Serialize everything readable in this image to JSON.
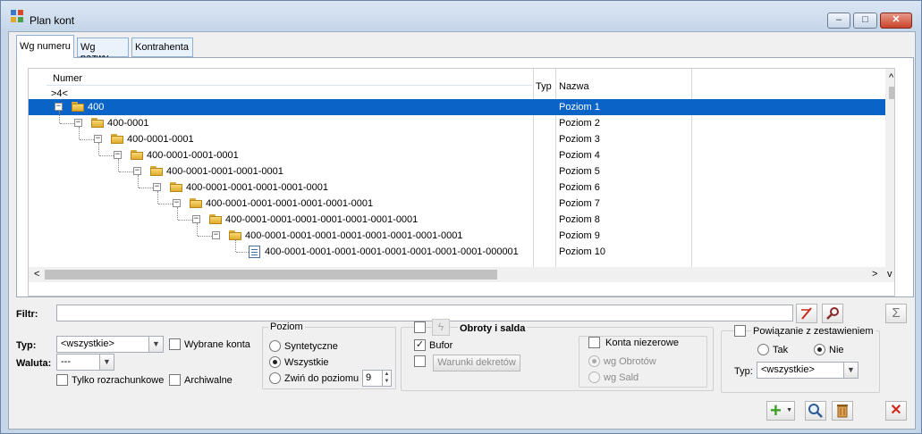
{
  "window": {
    "title": "Plan kont",
    "minimize": "–",
    "maximize": "□",
    "close": "✕"
  },
  "tabs": [
    "Wg numeru",
    "Wg nazwy",
    "Kontrahenta"
  ],
  "grid": {
    "col_numer": "Numer",
    "filter_value": ">4<",
    "col_typ": "Typ",
    "col_nazwa": "Nazwa",
    "rows": [
      {
        "numer": "400",
        "nazwa": "Poziom 1"
      },
      {
        "numer": "400-0001",
        "nazwa": "Poziom 2"
      },
      {
        "numer": "400-0001-0001",
        "nazwa": "Poziom 3"
      },
      {
        "numer": "400-0001-0001-0001",
        "nazwa": "Poziom 4"
      },
      {
        "numer": "400-0001-0001-0001-0001",
        "nazwa": "Poziom 5"
      },
      {
        "numer": "400-0001-0001-0001-0001-0001",
        "nazwa": "Poziom 6"
      },
      {
        "numer": "400-0001-0001-0001-0001-0001-0001",
        "nazwa": "Poziom 7"
      },
      {
        "numer": "400-0001-0001-0001-0001-0001-0001-0001",
        "nazwa": "Poziom 8"
      },
      {
        "numer": "400-0001-0001-0001-0001-0001-0001-0001-0001",
        "nazwa": "Poziom 9"
      },
      {
        "numer": "400-0001-0001-0001-0001-0001-0001-0001-0001-000001",
        "nazwa": "Poziom 10"
      }
    ],
    "expander_sign": "−",
    "scroll_up": "^",
    "scroll_down": "v",
    "scroll_left": "<",
    "scroll_right": ">"
  },
  "filter": {
    "label": "Filtr:",
    "value": "",
    "sigma": "Σ"
  },
  "left": {
    "typ_label": "Typ:",
    "typ_value": "<wszystkie>",
    "waluta_label": "Waluta:",
    "waluta_value": "---",
    "wybrane_konta": "Wybrane konta",
    "tylko_rozrachunkowe": "Tylko rozrachunkowe",
    "archiwalne": "Archiwalne"
  },
  "poziom": {
    "legend": "Poziom",
    "syntetyczne": "Syntetyczne",
    "wszystkie": "Wszystkie",
    "zwin": "Zwiń do poziomu",
    "zwin_value": "9",
    "selected": "Wszystkie"
  },
  "obroty": {
    "legend": "Obroty i salda",
    "bufor": "Bufor",
    "warunki": "Warunki dekretów",
    "konta_niezerowe": "Konta niezerowe",
    "wg_obrotow": "wg Obrotów",
    "wg_sald": "wg Sald"
  },
  "powiazanie": {
    "legend": "Powiązanie z zestawieniem",
    "tak": "Tak",
    "nie": "Nie",
    "selected": "Nie",
    "typ_label": "Typ:",
    "typ_value": "<wszystkie>"
  },
  "icons": {
    "add": "+",
    "zoom": "search-icon",
    "delete": "trash-icon",
    "close": "✕",
    "checkmark": "✓"
  },
  "colors": {
    "selection": "#0a64c8",
    "add_green": "#3fa02a",
    "close_red": "#d32a1c"
  }
}
